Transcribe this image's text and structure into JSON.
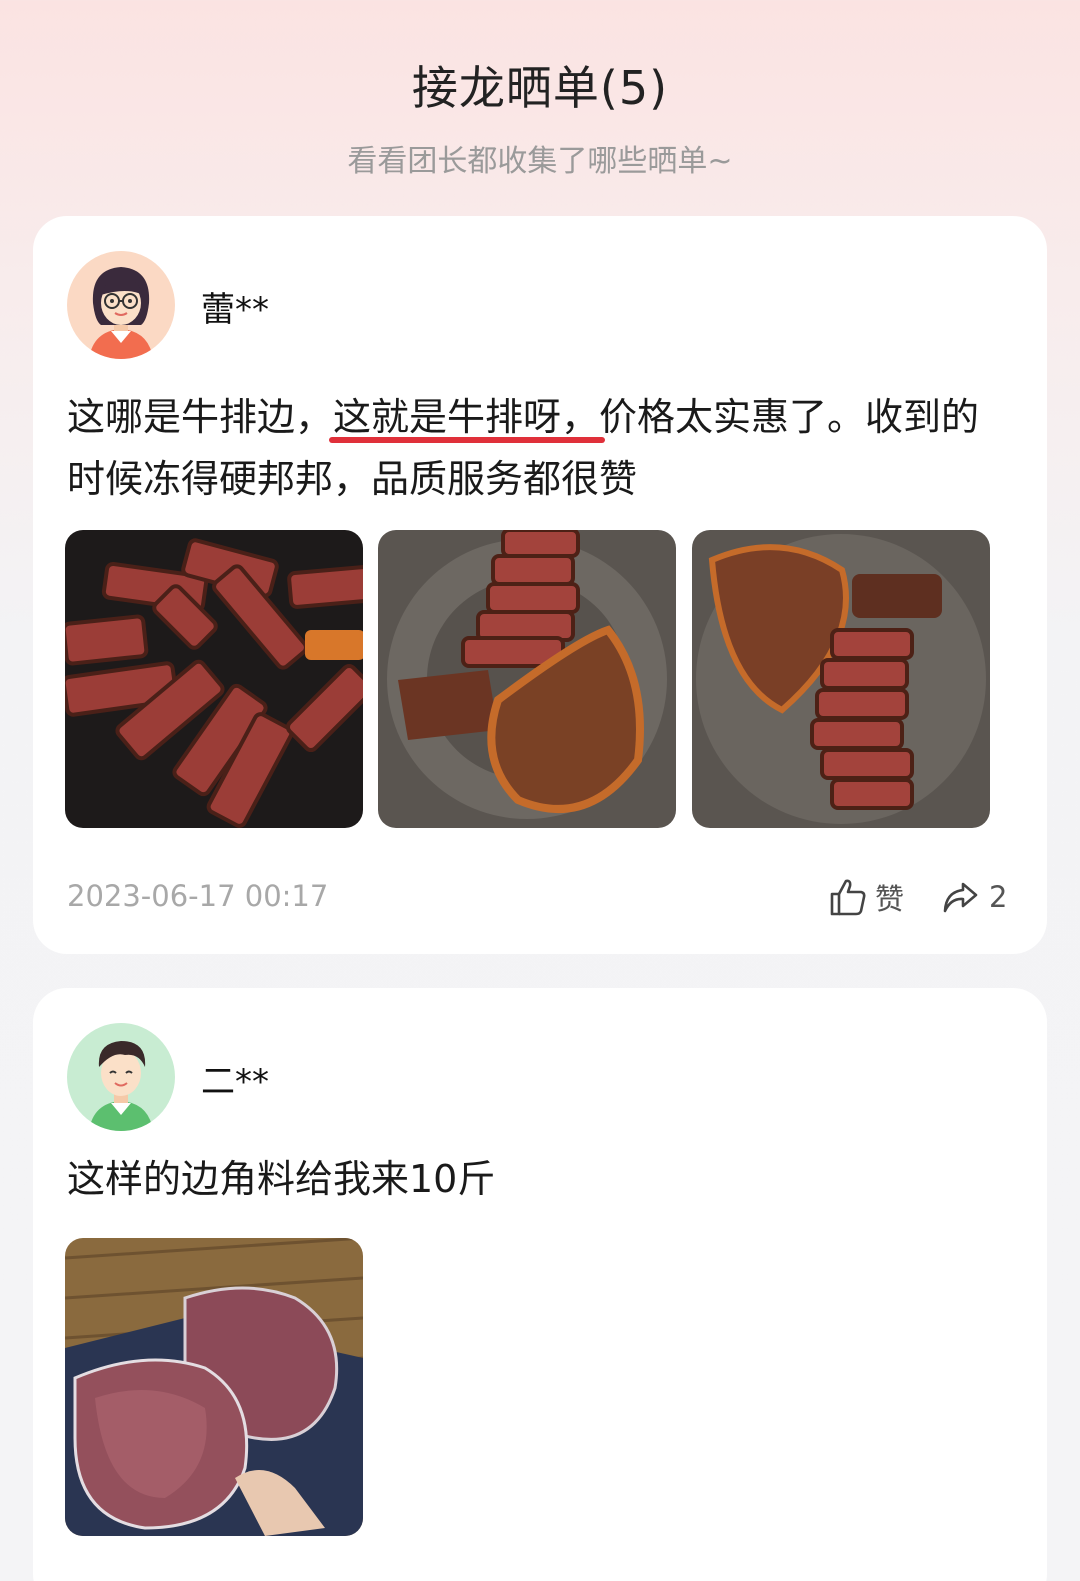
{
  "header": {
    "title": "接龙晒单(5)",
    "subtitle": "看看团长都收集了哪些晒单~"
  },
  "posts": [
    {
      "username": "蕾**",
      "text_before": "这哪是牛排边，",
      "text_highlight": "这就是牛排呀，",
      "text_after": "价格太实惠了。收到的时候冻得硬邦邦，品质服务都很赞",
      "photo_count": 3,
      "timestamp": "2023-06-17 00:17",
      "like_label": "赞",
      "share_count": "2"
    },
    {
      "username": "二**",
      "text": "这样的边角料给我来10斤",
      "photo_count": 1
    }
  ],
  "icons": {
    "like": "thumbs-up-icon",
    "share": "share-arrow-icon"
  },
  "colors": {
    "highlight_underline": "#e0303a",
    "avatar1_bg": "#fbd9c4",
    "avatar2_bg": "#c8ecd2"
  }
}
